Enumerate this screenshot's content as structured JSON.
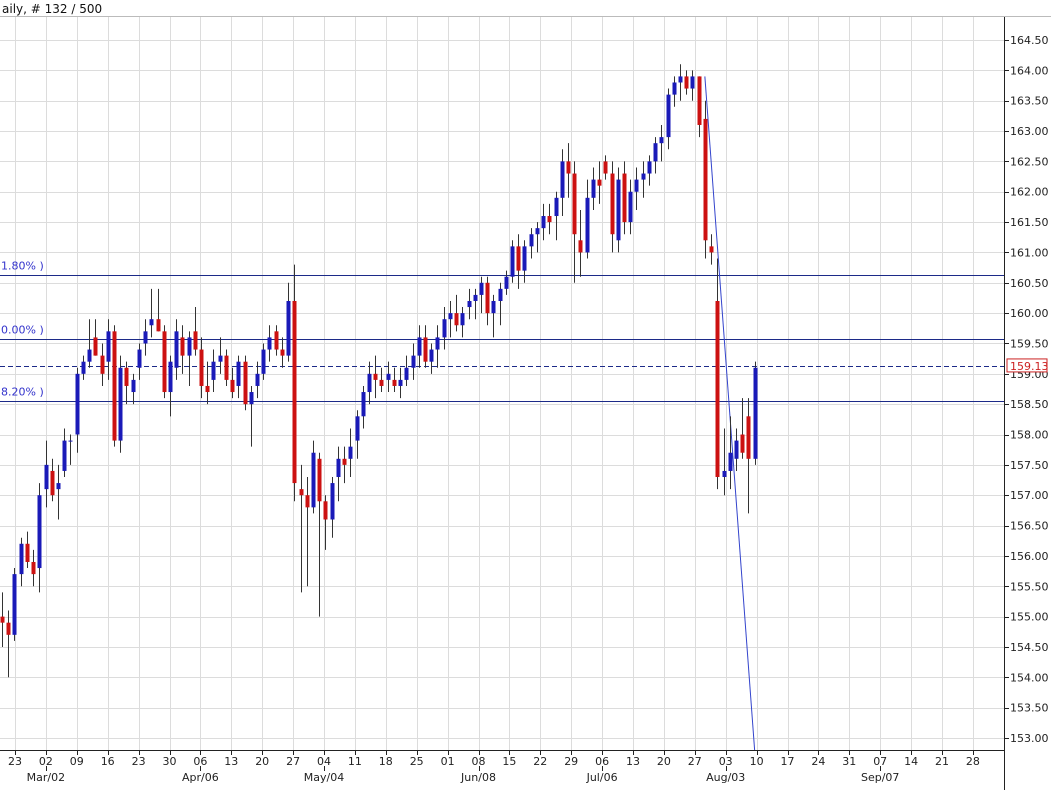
{
  "header": {
    "title": "aily, # 132 / 500"
  },
  "colors": {
    "up": "#1a1ab8",
    "down": "#cc1111",
    "wick": "#333333",
    "grid": "#dcdcdc",
    "level": "#1c2a88",
    "fib_text": "#3333cc",
    "price_box": "#cc2222"
  },
  "chart_data": {
    "type": "candlestick",
    "title": "",
    "ylim": [
      152.8,
      164.75
    ],
    "y_ticks": [
      "164.50",
      "164.00",
      "163.50",
      "163.00",
      "162.50",
      "162.00",
      "161.50",
      "161.00",
      "160.50",
      "160.00",
      "159.50",
      "159.00",
      "158.50",
      "158.00",
      "157.50",
      "157.00",
      "156.50",
      "156.00",
      "155.50",
      "155.00",
      "154.50",
      "154.00",
      "153.50",
      "153.00"
    ],
    "x_ticks": [
      "23",
      "02",
      "09",
      "16",
      "23",
      "30",
      "06",
      "13",
      "20",
      "27",
      "04",
      "11",
      "18",
      "25",
      "01",
      "08",
      "15",
      "22",
      "29",
      "06",
      "13",
      "20",
      "27",
      "03",
      "10",
      "17",
      "24",
      "31",
      "07",
      "14",
      "21",
      "28"
    ],
    "months": [
      {
        "label": "Mar/02",
        "tick_index": 1
      },
      {
        "label": "Apr/06",
        "tick_index": 6
      },
      {
        "label": "May/04",
        "tick_index": 10
      },
      {
        "label": "Jun/08",
        "tick_index": 15
      },
      {
        "label": "Jul/06",
        "tick_index": 19
      },
      {
        "label": "Aug/03",
        "tick_index": 23
      },
      {
        "label": "Sep/07",
        "tick_index": 28
      }
    ],
    "levels": [
      {
        "label": "1.80% )",
        "value": 160.62,
        "style": "solid"
      },
      {
        "label": "0.00% )",
        "value": 159.58,
        "style": "solid"
      },
      {
        "label": "8.20% )",
        "value": 158.55,
        "style": "solid"
      },
      {
        "label": "",
        "value": 159.13,
        "style": "dashed"
      }
    ],
    "last_price": "159.13",
    "trendline": [
      {
        "bar": 113,
        "price": 163.9
      },
      {
        "bar": 121,
        "price": 152.8
      }
    ],
    "candles": [
      [
        155.0,
        155.4,
        154.5,
        154.9
      ],
      [
        154.9,
        155.1,
        154.0,
        154.7
      ],
      [
        154.7,
        155.8,
        154.6,
        155.7
      ],
      [
        155.7,
        156.3,
        155.5,
        156.2
      ],
      [
        156.2,
        156.4,
        155.8,
        155.9
      ],
      [
        155.9,
        156.1,
        155.5,
        155.7
      ],
      [
        155.8,
        157.2,
        155.4,
        157.0
      ],
      [
        157.1,
        157.9,
        156.8,
        157.5
      ],
      [
        157.4,
        157.6,
        156.9,
        157.0
      ],
      [
        157.1,
        157.5,
        156.6,
        157.2
      ],
      [
        157.4,
        158.1,
        157.3,
        157.9
      ],
      [
        157.9,
        158.0,
        157.5,
        157.9
      ],
      [
        158.0,
        159.1,
        157.7,
        159.0
      ],
      [
        159.0,
        159.3,
        158.9,
        159.2
      ],
      [
        159.2,
        159.9,
        159.1,
        159.4
      ],
      [
        159.6,
        159.9,
        159.3,
        159.3
      ],
      [
        159.3,
        159.5,
        158.8,
        159.0
      ],
      [
        159.2,
        159.9,
        158.9,
        159.7
      ],
      [
        159.7,
        159.8,
        157.8,
        157.9
      ],
      [
        157.9,
        159.3,
        157.7,
        159.1
      ],
      [
        159.1,
        159.2,
        158.5,
        158.8
      ],
      [
        158.7,
        159.0,
        158.5,
        158.9
      ],
      [
        159.1,
        159.5,
        158.9,
        159.4
      ],
      [
        159.5,
        159.9,
        159.3,
        159.7
      ],
      [
        159.8,
        160.4,
        159.6,
        159.9
      ],
      [
        159.9,
        160.4,
        159.7,
        159.7
      ],
      [
        159.7,
        159.8,
        158.6,
        158.7
      ],
      [
        158.7,
        159.3,
        158.3,
        159.2
      ],
      [
        159.1,
        159.9,
        158.9,
        159.7
      ],
      [
        159.6,
        159.8,
        159.0,
        159.3
      ],
      [
        159.3,
        159.7,
        158.8,
        159.6
      ],
      [
        159.7,
        160.1,
        159.3,
        159.4
      ],
      [
        159.4,
        159.6,
        158.6,
        158.8
      ],
      [
        158.8,
        159.2,
        158.5,
        158.7
      ],
      [
        158.9,
        159.4,
        158.7,
        159.2
      ],
      [
        159.2,
        159.6,
        159.0,
        159.3
      ],
      [
        159.3,
        159.4,
        158.8,
        158.9
      ],
      [
        158.9,
        159.1,
        158.6,
        158.7
      ],
      [
        158.8,
        159.3,
        158.6,
        159.2
      ],
      [
        159.2,
        159.3,
        158.4,
        158.5
      ],
      [
        158.5,
        158.8,
        157.8,
        158.7
      ],
      [
        158.8,
        159.2,
        158.6,
        159.0
      ],
      [
        159.0,
        159.5,
        158.9,
        159.4
      ],
      [
        159.4,
        159.8,
        159.2,
        159.6
      ],
      [
        159.7,
        159.8,
        159.3,
        159.4
      ],
      [
        159.4,
        159.6,
        159.1,
        159.3
      ],
      [
        159.3,
        160.5,
        159.2,
        160.2
      ],
      [
        160.2,
        160.8,
        156.9,
        157.2
      ],
      [
        157.1,
        157.5,
        155.4,
        157.0
      ],
      [
        157.0,
        157.3,
        155.5,
        156.8
      ],
      [
        156.8,
        157.9,
        156.7,
        157.7
      ],
      [
        157.6,
        157.7,
        155.0,
        156.9
      ],
      [
        156.9,
        157.0,
        156.1,
        156.6
      ],
      [
        156.6,
        157.3,
        156.3,
        157.2
      ],
      [
        157.3,
        157.8,
        156.9,
        157.6
      ],
      [
        157.6,
        157.8,
        157.2,
        157.5
      ],
      [
        157.6,
        158.1,
        157.3,
        157.8
      ],
      [
        157.9,
        158.4,
        157.6,
        158.3
      ],
      [
        158.3,
        158.8,
        158.1,
        158.7
      ],
      [
        158.7,
        159.2,
        158.5,
        159.0
      ],
      [
        159.0,
        159.3,
        158.6,
        158.9
      ],
      [
        158.9,
        159.1,
        158.7,
        158.8
      ],
      [
        158.9,
        159.2,
        158.7,
        159.0
      ],
      [
        158.9,
        159.1,
        158.7,
        158.8
      ],
      [
        158.8,
        159.1,
        158.6,
        158.9
      ],
      [
        158.9,
        159.3,
        158.8,
        159.1
      ],
      [
        159.1,
        159.5,
        158.9,
        159.3
      ],
      [
        159.3,
        159.8,
        159.1,
        159.6
      ],
      [
        159.6,
        159.8,
        159.1,
        159.2
      ],
      [
        159.2,
        159.5,
        159.0,
        159.4
      ],
      [
        159.4,
        159.8,
        159.1,
        159.6
      ],
      [
        159.6,
        160.1,
        159.4,
        159.9
      ],
      [
        159.9,
        160.2,
        159.6,
        160.0
      ],
      [
        160.0,
        160.3,
        159.7,
        159.8
      ],
      [
        159.8,
        160.1,
        159.6,
        160.0
      ],
      [
        160.1,
        160.4,
        159.9,
        160.2
      ],
      [
        160.2,
        160.4,
        159.9,
        160.3
      ],
      [
        160.3,
        160.6,
        160.0,
        160.5
      ],
      [
        160.5,
        160.6,
        159.8,
        160.0
      ],
      [
        160.0,
        160.3,
        159.6,
        160.2
      ],
      [
        160.2,
        160.5,
        159.8,
        160.4
      ],
      [
        160.4,
        160.7,
        160.3,
        160.6
      ],
      [
        160.6,
        161.2,
        160.5,
        161.1
      ],
      [
        161.1,
        161.3,
        160.4,
        160.7
      ],
      [
        160.7,
        161.2,
        160.5,
        161.1
      ],
      [
        161.1,
        161.4,
        160.9,
        161.3
      ],
      [
        161.3,
        161.5,
        161.0,
        161.4
      ],
      [
        161.4,
        161.8,
        161.2,
        161.6
      ],
      [
        161.6,
        161.8,
        161.3,
        161.5
      ],
      [
        161.6,
        162.0,
        161.2,
        161.9
      ],
      [
        161.9,
        162.7,
        161.6,
        162.5
      ],
      [
        162.5,
        162.8,
        161.9,
        162.3
      ],
      [
        162.3,
        162.5,
        160.5,
        161.3
      ],
      [
        161.2,
        161.7,
        160.6,
        161.0
      ],
      [
        161.0,
        162.2,
        160.9,
        161.9
      ],
      [
        161.9,
        162.4,
        161.7,
        162.2
      ],
      [
        162.2,
        162.5,
        161.8,
        162.1
      ],
      [
        162.5,
        162.6,
        162.2,
        162.3
      ],
      [
        162.3,
        162.5,
        161.0,
        161.3
      ],
      [
        161.2,
        162.4,
        161.0,
        162.2
      ],
      [
        162.3,
        162.5,
        161.3,
        161.5
      ],
      [
        161.5,
        162.2,
        161.3,
        162.0
      ],
      [
        162.0,
        162.4,
        161.7,
        162.2
      ],
      [
        162.2,
        162.5,
        161.9,
        162.3
      ],
      [
        162.3,
        162.6,
        162.1,
        162.5
      ],
      [
        162.5,
        162.9,
        162.3,
        162.8
      ],
      [
        162.8,
        163.1,
        162.5,
        162.9
      ],
      [
        162.9,
        163.7,
        162.7,
        163.6
      ],
      [
        163.6,
        163.9,
        163.4,
        163.8
      ],
      [
        163.8,
        164.1,
        163.5,
        163.9
      ],
      [
        163.9,
        164.0,
        163.6,
        163.7
      ],
      [
        163.7,
        164.0,
        163.5,
        163.9
      ],
      [
        163.9,
        163.9,
        162.9,
        163.1
      ],
      [
        163.2,
        163.5,
        160.9,
        161.2
      ],
      [
        161.1,
        161.3,
        160.8,
        161.0
      ],
      [
        160.2,
        160.9,
        157.1,
        157.3
      ],
      [
        157.3,
        158.1,
        157.0,
        157.4
      ],
      [
        157.4,
        158.3,
        157.1,
        157.7
      ],
      [
        157.6,
        158.1,
        157.4,
        157.9
      ],
      [
        158.0,
        158.6,
        157.6,
        157.7
      ],
      [
        158.3,
        158.6,
        156.7,
        157.6
      ],
      [
        157.6,
        159.2,
        157.5,
        159.1
      ]
    ]
  }
}
